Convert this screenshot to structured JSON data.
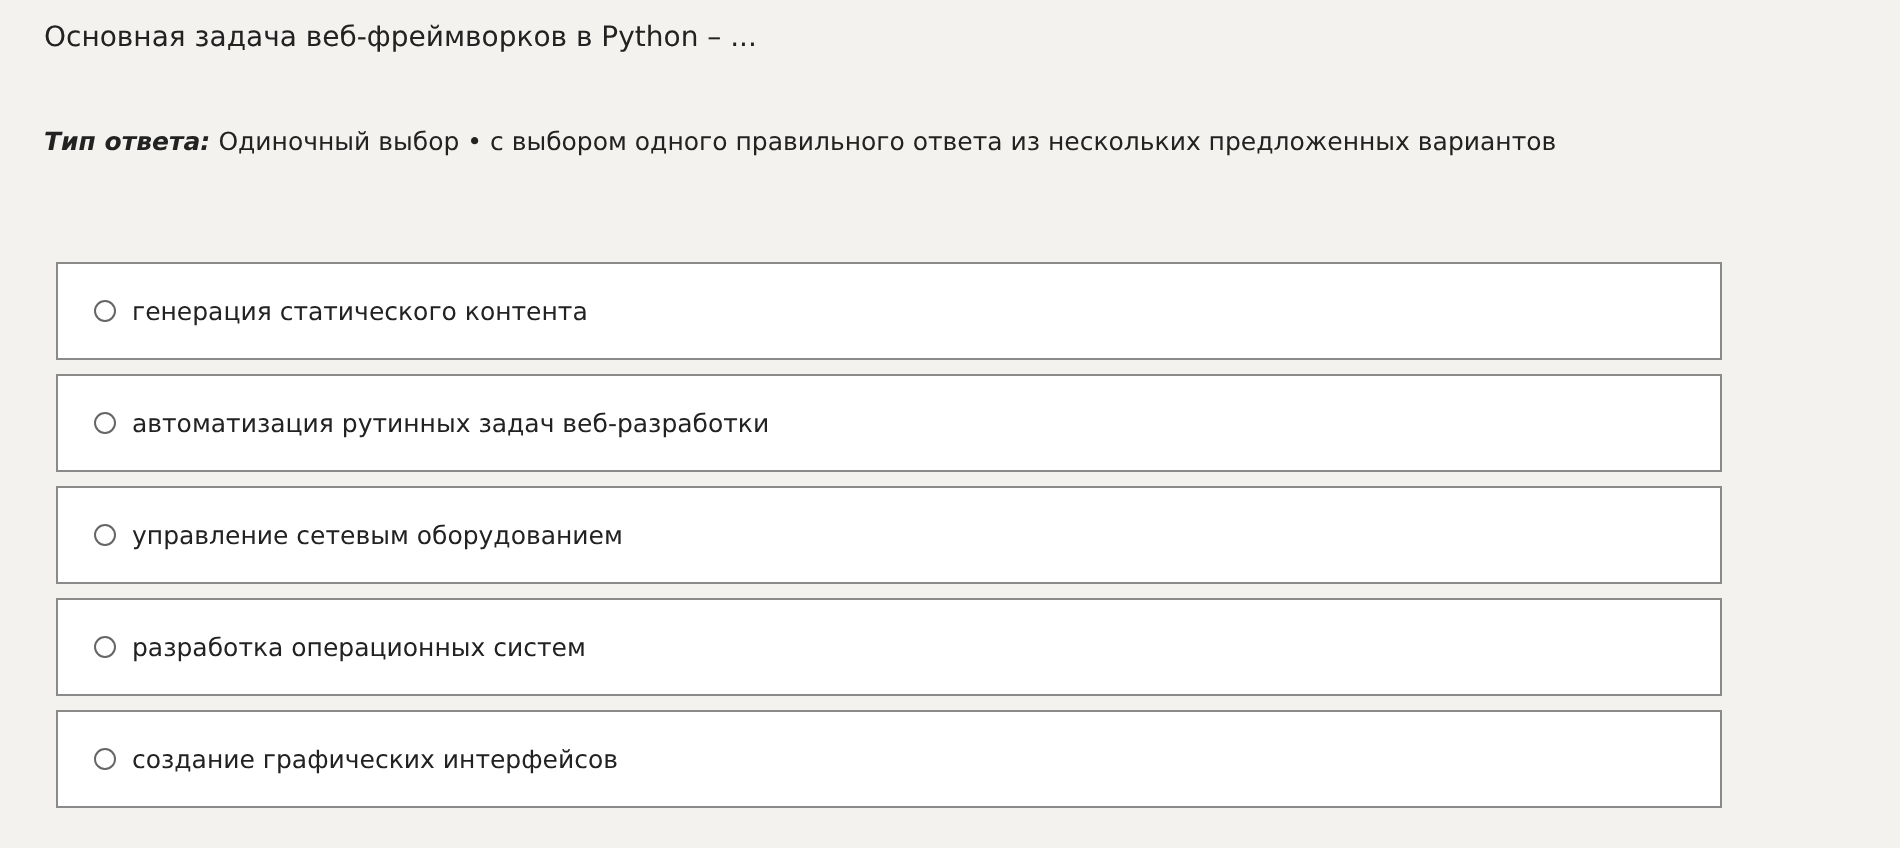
{
  "question": {
    "text": "Основная задача веб-фреймворков в Python – ..."
  },
  "answer_type": {
    "label": "Тип ответа:",
    "value": "Одиночный выбор • с выбором одного правильного ответа из нескольких предложенных вариантов"
  },
  "options": [
    {
      "label": "генерация статического контента",
      "selected": false
    },
    {
      "label": "автоматизация рутинных задач веб-разработки",
      "selected": false
    },
    {
      "label": "управление сетевым оборудованием",
      "selected": false
    },
    {
      "label": "разработка операционных систем",
      "selected": false
    },
    {
      "label": "создание графических интерфейсов",
      "selected": false
    }
  ]
}
